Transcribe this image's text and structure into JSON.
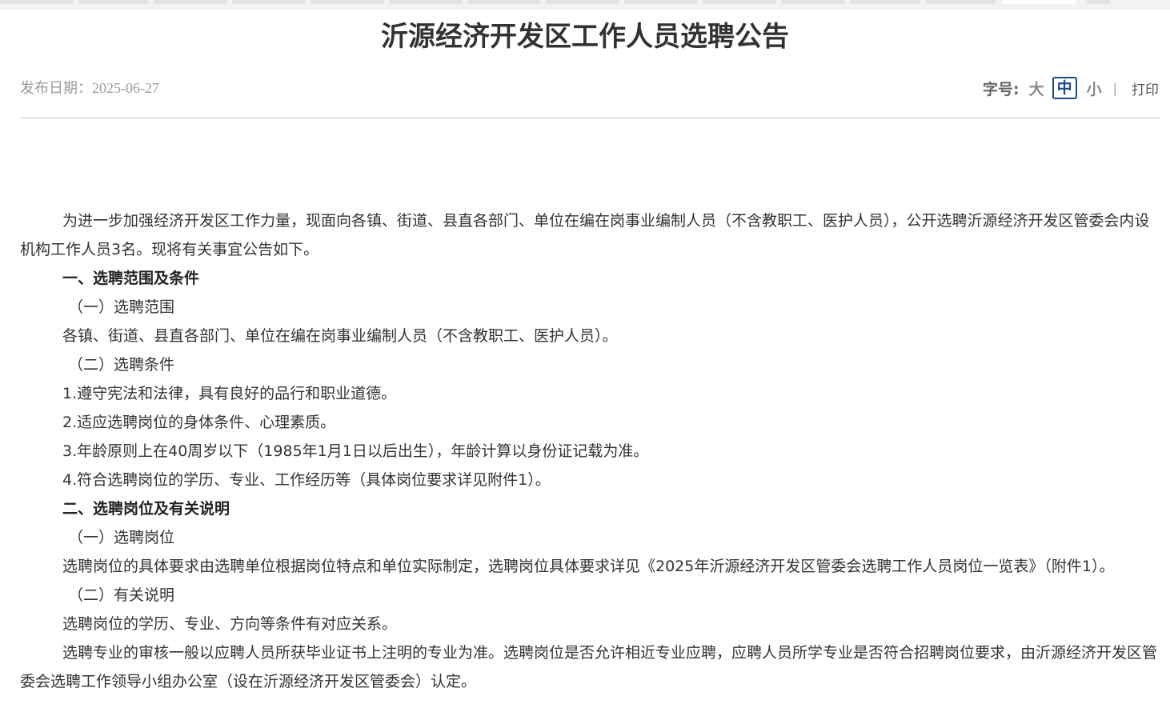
{
  "article": {
    "title": "沂源经济开发区工作人员选聘公告",
    "publish_label": "发布日期：",
    "publish_date": "2025-06-27"
  },
  "font_controls": {
    "label": "字号:",
    "large": "大",
    "medium": "中",
    "small": "小",
    "separator": "|",
    "print": "打印",
    "selected": "中"
  },
  "body": {
    "intro": "为进一步加强经济开发区工作力量，现面向各镇、街道、县直各部门、单位在编在岗事业编制人员（不含教职工、医护人员），公开选聘沂源经济开发区管委会内设机构工作人员3名。现将有关事宜公告如下。",
    "section1_heading": "一、选聘范围及条件",
    "s1_sub1": "（一）选聘范围",
    "s1_sub1_text": "各镇、街道、县直各部门、单位在编在岗事业编制人员（不含教职工、医护人员）。",
    "s1_sub2": "（二）选聘条件",
    "conditions": [
      "1.遵守宪法和法律，具有良好的品行和职业道德。",
      "2.适应选聘岗位的身体条件、心理素质。",
      "3.年龄原则上在40周岁以下（1985年1月1日以后出生），年龄计算以身份证记载为准。",
      "4.符合选聘岗位的学历、专业、工作经历等（具体岗位要求详见附件1）。"
    ],
    "section2_heading": "二、选聘岗位及有关说明",
    "s2_sub1": "（一）选聘岗位",
    "s2_sub1_text": "选聘岗位的具体要求由选聘单位根据岗位特点和单位实际制定，选聘岗位具体要求详见《2025年沂源经济开发区管委会选聘工作人员岗位一览表》（附件1）。",
    "s2_sub2": "（二）有关说明",
    "s2_sub2_text1": "选聘岗位的学历、专业、方向等条件有对应关系。",
    "s2_sub2_text2": "选聘专业的审核一般以应聘人员所获毕业证书上注明的专业为准。选聘岗位是否允许相近专业应聘，应聘人员所学专业是否符合招聘岗位要求，由沂源经济开发区管委会选聘工作领导小组办公室（设在沂源经济开发区管委会）认定。"
  }
}
